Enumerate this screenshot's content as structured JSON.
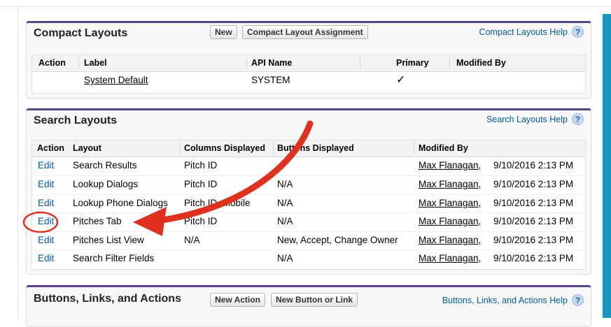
{
  "compact": {
    "title": "Compact Layouts",
    "new_label": "New",
    "assign_label": "Compact Layout Assignment",
    "help_label": "Compact Layouts Help",
    "help_icon": "question-icon",
    "headers": {
      "action": "Action",
      "label": "Label",
      "api": "API Name",
      "primary": "Primary",
      "modified": "Modified By"
    },
    "row": {
      "label": "System Default",
      "api": "SYSTEM",
      "primary_mark": "✓"
    }
  },
  "search": {
    "title": "Search Layouts",
    "help_label": "Search Layouts Help",
    "headers": {
      "action": "Action",
      "layout": "Layout",
      "columns": "Columns Displayed",
      "buttons": "Buttons Displayed",
      "modified": "Modified By"
    },
    "rows": [
      {
        "action": "Edit",
        "layout": "Search Results",
        "columns": "Pitch ID",
        "buttons": "",
        "user": "Max Flanagan,",
        "date": "9/10/2016 2:13 PM"
      },
      {
        "action": "Edit",
        "layout": "Lookup Dialogs",
        "columns": "Pitch ID",
        "buttons": "N/A",
        "user": "Max Flanagan,",
        "date": "9/10/2016 2:13 PM"
      },
      {
        "action": "Edit",
        "layout": "Lookup Phone Dialogs",
        "columns": "Pitch ID, Mobile",
        "buttons": "N/A",
        "user": "Max Flanagan,",
        "date": "9/10/2016 2:13 PM"
      },
      {
        "action": "Edit",
        "layout": "Pitches Tab",
        "columns": "Pitch ID",
        "buttons": "N/A",
        "user": "Max Flanagan,",
        "date": "9/10/2016 2:13 PM"
      },
      {
        "action": "Edit",
        "layout": "Pitches List View",
        "columns": "N/A",
        "buttons": "New, Accept, Change Owner",
        "user": "Max Flanagan,",
        "date": "9/10/2016 2:13 PM"
      },
      {
        "action": "Edit",
        "layout": "Search Filter Fields",
        "columns": "",
        "buttons": "N/A",
        "user": "Max Flanagan,",
        "date": "9/10/2016 2:13 PM"
      }
    ]
  },
  "buttons_panel": {
    "title": "Buttons, Links, and Actions",
    "new_action_label": "New Action",
    "new_button_label": "New Button or Link",
    "help_label": "Buttons, Links, and Actions Help"
  },
  "annotation": {
    "arrow_color": "#e0301e",
    "circle_color": "#e0301e"
  }
}
